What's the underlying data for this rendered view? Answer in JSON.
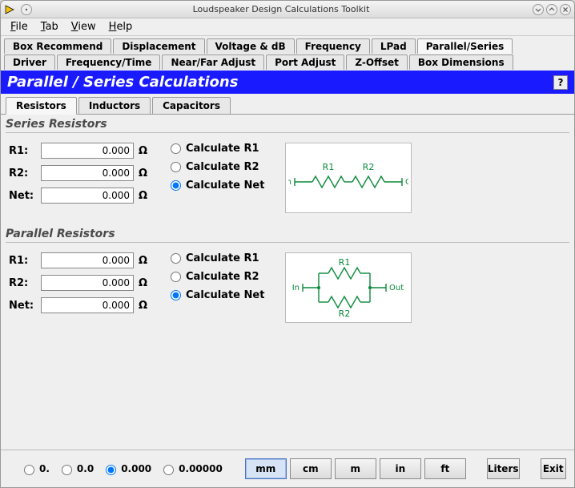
{
  "window": {
    "title": "Loudspeaker Design Calculations Toolkit"
  },
  "menubar": {
    "file": "File",
    "tab": "Tab",
    "view": "View",
    "help": "Help"
  },
  "tabs_row1": [
    {
      "label": "Box Recommend",
      "active": false
    },
    {
      "label": "Displacement",
      "active": false
    },
    {
      "label": "Voltage & dB",
      "active": false
    },
    {
      "label": "Frequency",
      "active": false
    },
    {
      "label": "LPad",
      "active": false
    },
    {
      "label": "Parallel/Series",
      "active": true
    }
  ],
  "tabs_row2": [
    {
      "label": "Driver",
      "active": false
    },
    {
      "label": "Frequency/Time",
      "active": false
    },
    {
      "label": "Near/Far Adjust",
      "active": false
    },
    {
      "label": "Port Adjust",
      "active": false
    },
    {
      "label": "Z-Offset",
      "active": false
    },
    {
      "label": "Box Dimensions",
      "active": false
    }
  ],
  "panel": {
    "title": "Parallel / Series Calculations",
    "help": "?"
  },
  "subtabs": [
    {
      "label": "Resistors",
      "active": true
    },
    {
      "label": "Inductors",
      "active": false
    },
    {
      "label": "Capacitors",
      "active": false
    }
  ],
  "series": {
    "title": "Series Resistors",
    "labels": {
      "r1": "R1:",
      "r2": "R2:",
      "net": "Net:"
    },
    "values": {
      "r1": "0.000",
      "r2": "0.000",
      "net": "0.000"
    },
    "unit": "Ω",
    "radios": {
      "r1": "Calculate R1",
      "r2": "Calculate R2",
      "net": "Calculate Net"
    },
    "selected": "net",
    "diagram": {
      "in": "In",
      "out": "Out",
      "r1": "R1",
      "r2": "R2"
    }
  },
  "parallel": {
    "title": "Parallel Resistors",
    "labels": {
      "r1": "R1:",
      "r2": "R2:",
      "net": "Net:"
    },
    "values": {
      "r1": "0.000",
      "r2": "0.000",
      "net": "0.000"
    },
    "unit": "Ω",
    "radios": {
      "r1": "Calculate R1",
      "r2": "Calculate R2",
      "net": "Calculate Net"
    },
    "selected": "net",
    "diagram": {
      "in": "In",
      "out": "Out",
      "r1": "R1",
      "r2": "R2"
    }
  },
  "footer": {
    "precisions": [
      {
        "label": "0.",
        "checked": false
      },
      {
        "label": "0.0",
        "checked": false
      },
      {
        "label": "0.000",
        "checked": true
      },
      {
        "label": "0.00000",
        "checked": false
      }
    ],
    "units": [
      {
        "label": "mm",
        "active": true
      },
      {
        "label": "cm",
        "active": false
      },
      {
        "label": "m",
        "active": false
      },
      {
        "label": "in",
        "active": false
      },
      {
        "label": "ft",
        "active": false
      }
    ],
    "liters": "Liters",
    "exit": "Exit"
  }
}
